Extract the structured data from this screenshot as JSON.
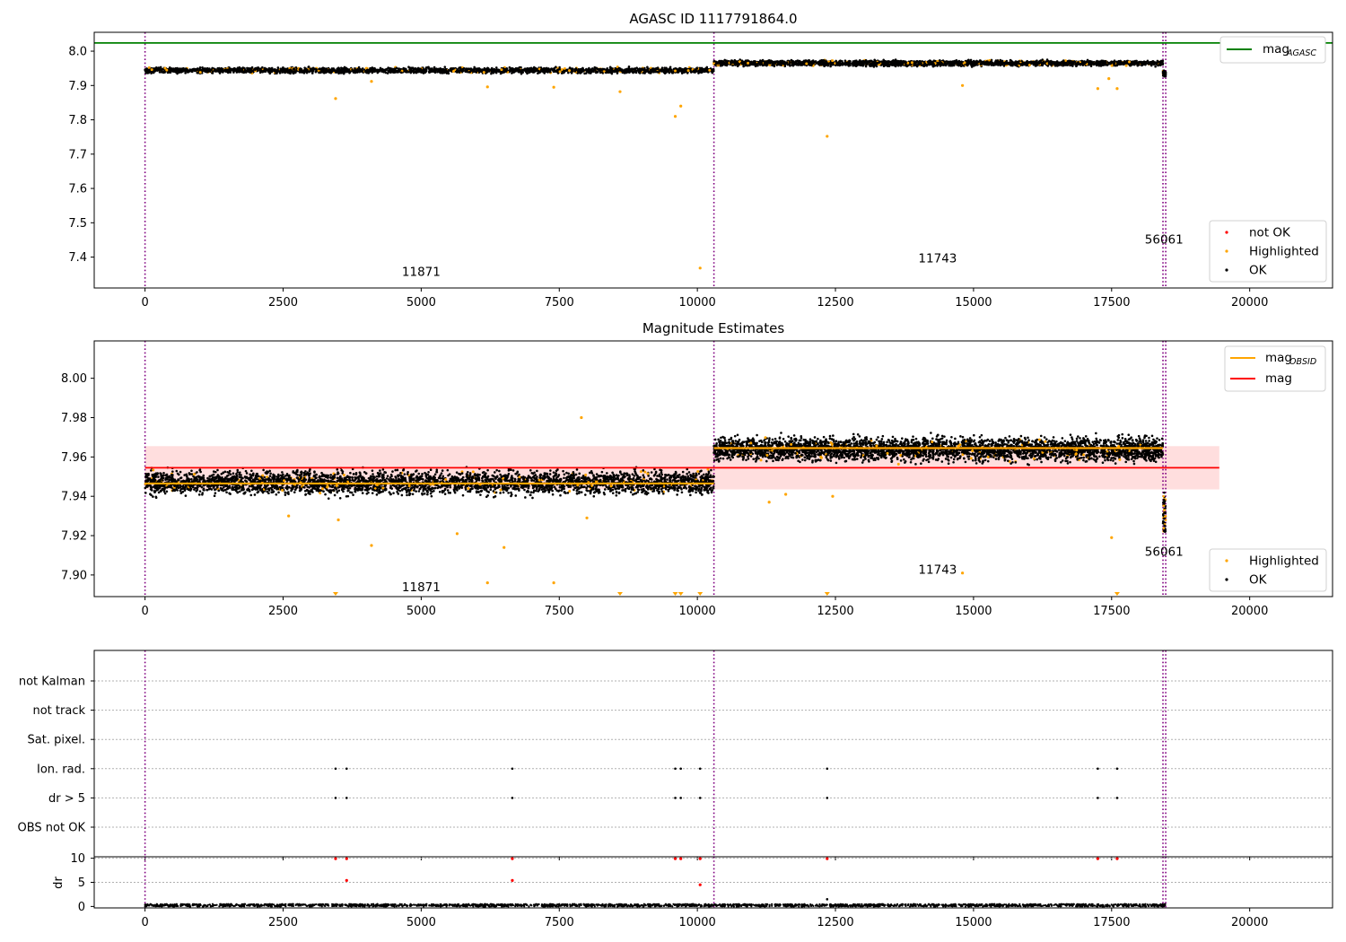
{
  "chart_data": [
    {
      "type": "scatter",
      "title": "AGASC ID 1117791864.0",
      "xlim": [
        -920,
        21500
      ],
      "ylim": [
        7.31,
        8.055
      ],
      "xticks": [
        0,
        2500,
        5000,
        7500,
        10000,
        12500,
        15000,
        17500,
        20000
      ],
      "yticks": [
        7.4,
        7.5,
        7.6,
        7.7,
        7.8,
        7.9,
        8.0
      ],
      "ytick_labels": [
        "7.4",
        "7.5",
        "7.6",
        "7.7",
        "7.8",
        "7.9",
        "8.0"
      ],
      "hline": {
        "name": "mag",
        "subscript": "AGASC",
        "y": 8.024,
        "color": "#008000"
      },
      "observation_boundaries": [
        0,
        10300,
        18430,
        18480
      ],
      "obsid_labels": [
        {
          "text": "11871",
          "x": 5000,
          "y": 7.345
        },
        {
          "text": "11743",
          "x": 14350,
          "y": 7.385
        },
        {
          "text": "56061",
          "x": 18450,
          "y": 7.44
        }
      ],
      "segments": [
        {
          "x": [
            0,
            10300
          ],
          "center": 7.944,
          "spread": 0.012
        },
        {
          "x": [
            10300,
            18430
          ],
          "center": 7.965,
          "spread": 0.012
        },
        {
          "x": [
            18430,
            18480
          ],
          "center": 7.935,
          "spread": 0.012
        }
      ],
      "highlighted_points": [
        {
          "x": 3450,
          "y": 7.862
        },
        {
          "x": 4100,
          "y": 7.912
        },
        {
          "x": 6200,
          "y": 7.896
        },
        {
          "x": 7400,
          "y": 7.895
        },
        {
          "x": 8600,
          "y": 7.882
        },
        {
          "x": 9600,
          "y": 7.81
        },
        {
          "x": 9700,
          "y": 7.84
        },
        {
          "x": 10050,
          "y": 7.368
        },
        {
          "x": 12350,
          "y": 7.752
        },
        {
          "x": 14800,
          "y": 7.9
        },
        {
          "x": 17250,
          "y": 7.891
        },
        {
          "x": 17600,
          "y": 7.891
        },
        {
          "x": 17450,
          "y": 7.92
        }
      ],
      "legend_lines": [
        {
          "label": "mag",
          "subscript": "AGASC",
          "color": "#008000"
        }
      ],
      "legend_points": [
        {
          "label": "not OK",
          "color": "#ff0000"
        },
        {
          "label": "Highlighted",
          "color": "#ffa500"
        },
        {
          "label": "OK",
          "color": "#000000"
        }
      ],
      "legend_placement": [
        "top-right",
        "bottom-right"
      ]
    },
    {
      "type": "scatter",
      "title": "Magnitude Estimates",
      "xlim": [
        -920,
        21500
      ],
      "ylim": [
        7.889,
        8.019
      ],
      "xticks": [
        0,
        2500,
        5000,
        7500,
        10000,
        12500,
        15000,
        17500,
        20000
      ],
      "yticks": [
        7.9,
        7.92,
        7.94,
        7.96,
        7.98,
        8.0
      ],
      "ytick_labels": [
        "7.90",
        "7.92",
        "7.94",
        "7.96",
        "7.98",
        "8.00"
      ],
      "mag_line": {
        "name": "mag",
        "y": 7.9545,
        "color": "#ff0000",
        "band": [
          7.9435,
          7.9655
        ]
      },
      "mag_obsid_steps": [
        {
          "x": [
            0,
            10300
          ],
          "y": 7.9465
        },
        {
          "x": [
            10300,
            18430
          ],
          "y": 7.9645
        },
        {
          "x": [
            18430,
            18480
          ],
          "y": 7.933
        }
      ],
      "observation_boundaries": [
        0,
        10300,
        18430,
        18480
      ],
      "obsid_labels": [
        {
          "text": "11871",
          "x": 5000,
          "y": 7.894
        },
        {
          "text": "11743",
          "x": 14350,
          "y": 7.903
        },
        {
          "text": "56061",
          "x": 18450,
          "y": 7.912
        }
      ],
      "segments": [
        {
          "x": [
            0,
            10300
          ],
          "center": 7.947,
          "spread": 0.009
        },
        {
          "x": [
            10300,
            18430
          ],
          "center": 7.964,
          "spread": 0.009
        }
      ],
      "highlighted_points": [
        {
          "x": 3500,
          "y": 7.928
        },
        {
          "x": 4100,
          "y": 7.915
        },
        {
          "x": 5650,
          "y": 7.921
        },
        {
          "x": 6200,
          "y": 7.896
        },
        {
          "x": 6500,
          "y": 7.914
        },
        {
          "x": 7400,
          "y": 7.896
        },
        {
          "x": 7900,
          "y": 7.98
        },
        {
          "x": 11300,
          "y": 7.937
        },
        {
          "x": 11600,
          "y": 7.941
        },
        {
          "x": 12450,
          "y": 7.94
        },
        {
          "x": 14800,
          "y": 7.901
        },
        {
          "x": 17500,
          "y": 7.919
        },
        {
          "x": 8000,
          "y": 7.929
        },
        {
          "x": 2600,
          "y": 7.93
        }
      ],
      "clipped_markers_x": [
        3450,
        8600,
        9600,
        9700,
        10050,
        12350,
        17600
      ],
      "legend_lines": [
        {
          "label": "mag",
          "subscript": "OBSID",
          "color": "#ffa500"
        },
        {
          "label": "mag",
          "subscript": "",
          "color": "#ff0000"
        }
      ],
      "legend_points": [
        {
          "label": "Highlighted",
          "color": "#ffa500"
        },
        {
          "label": "OK",
          "color": "#000000"
        }
      ],
      "legend_placement": [
        "top-right",
        "bottom-right"
      ]
    },
    {
      "type": "scatter",
      "title": "",
      "xlim": [
        -920,
        21500
      ],
      "xticks": [
        0,
        2500,
        5000,
        7500,
        10000,
        12500,
        15000,
        17500,
        20000
      ],
      "flag_rows": [
        "not Kalman",
        "not track",
        "Sat. pixel.",
        "Ion. rad.",
        "dr > 5",
        "OBS not OK"
      ],
      "flag_events": [
        {
          "flag": "Ion. rad.",
          "x": [
            3450,
            3650,
            6650,
            9600,
            9700,
            10050,
            12350,
            17250,
            17600
          ]
        },
        {
          "flag": "dr > 5",
          "x": [
            3450,
            3650,
            6650,
            9600,
            9700,
            10050,
            12350,
            17250,
            17600
          ]
        }
      ],
      "observation_boundaries": [
        0,
        10300,
        18430,
        18480
      ]
    },
    {
      "type": "scatter",
      "title": "",
      "xlim": [
        -920,
        21500
      ],
      "ylim": [
        -0.3,
        10.3
      ],
      "ylabel": "dr",
      "yticks": [
        0,
        5,
        10
      ],
      "ytick_labels": [
        "0",
        "5",
        "10"
      ],
      "xticks": [
        0,
        2500,
        5000,
        7500,
        10000,
        12500,
        15000,
        17500,
        20000
      ],
      "xtick_labels": [
        "0",
        "2500",
        "5000",
        "7500",
        "10000",
        "12500",
        "15000",
        "17500",
        "20000"
      ],
      "baseline": {
        "center": 0.25,
        "spread": 0.25,
        "x": [
          0,
          18480
        ]
      },
      "not_ok_points": [
        {
          "x": 3450,
          "y": 9.9
        },
        {
          "x": 3650,
          "y": 9.9
        },
        {
          "x": 3650,
          "y": 5.4
        },
        {
          "x": 6650,
          "y": 9.9
        },
        {
          "x": 6650,
          "y": 5.4
        },
        {
          "x": 9600,
          "y": 9.9
        },
        {
          "x": 9700,
          "y": 9.9
        },
        {
          "x": 10050,
          "y": 9.9
        },
        {
          "x": 10050,
          "y": 4.5
        },
        {
          "x": 12350,
          "y": 9.9
        },
        {
          "x": 17250,
          "y": 9.9
        },
        {
          "x": 17600,
          "y": 9.9
        }
      ],
      "ok_points": [
        {
          "x": 12350,
          "y": 1.5
        }
      ],
      "observation_boundaries": [
        0,
        10300,
        18430,
        18480
      ]
    }
  ]
}
